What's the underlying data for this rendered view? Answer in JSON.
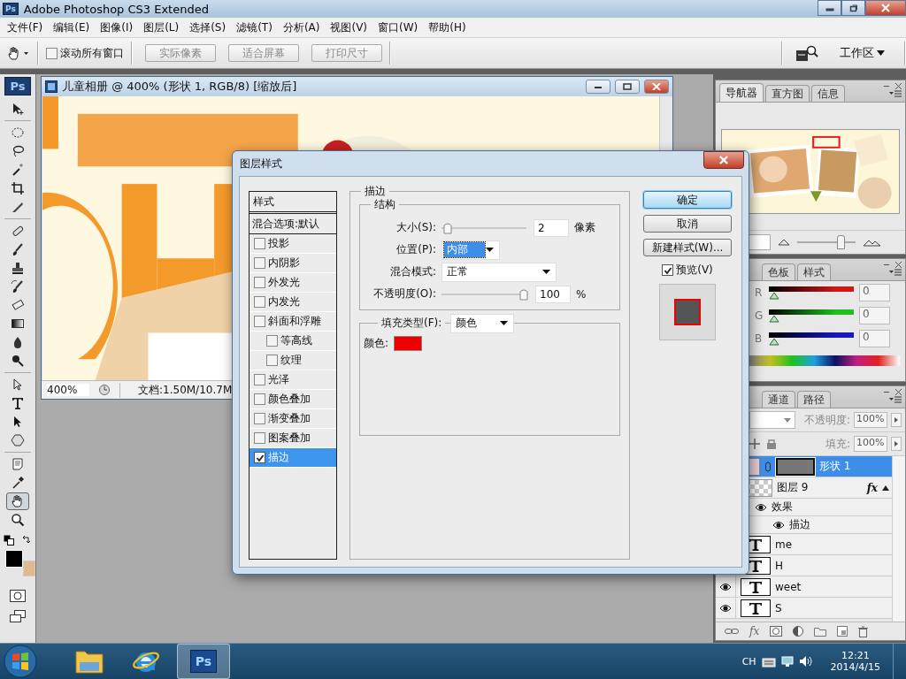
{
  "app": {
    "logo": "Ps",
    "title": "Adobe Photoshop CS3 Extended"
  },
  "menu": [
    "文件(F)",
    "编辑(E)",
    "图像(I)",
    "图层(L)",
    "选择(S)",
    "滤镜(T)",
    "分析(A)",
    "视图(V)",
    "窗口(W)",
    "帮助(H)"
  ],
  "options_bar": {
    "scroll_all": {
      "label": "滚动所有窗口",
      "checked": false
    },
    "buttons": [
      {
        "label": "实际像素",
        "disabled": true
      },
      {
        "label": "适合屏幕",
        "disabled": true
      },
      {
        "label": "打印尺寸",
        "disabled": true
      }
    ],
    "workspace": "工作区"
  },
  "toolbox": {
    "logo": "Ps",
    "tools": [
      {
        "selected": false
      },
      {
        "selected": false
      },
      {
        "selected": false
      },
      {
        "selected": false
      },
      {
        "selected": false
      },
      {
        "selected": false
      },
      {
        "selected": false
      },
      {
        "selected": false
      },
      {
        "selected": false
      },
      {
        "selected": false
      },
      {
        "selected": false
      },
      {
        "selected": false
      },
      {
        "selected": false
      },
      {
        "selected": false
      },
      {
        "selected": false
      },
      {
        "selected": false
      },
      {
        "selected": false
      },
      {
        "selected": false
      },
      {
        "selected": false
      },
      {
        "selected": false
      },
      {
        "selected": true
      },
      {
        "selected": false
      }
    ],
    "swatches": [
      {
        "kind": "foreground",
        "color": "#000000"
      },
      {
        "kind": "background",
        "color": "#e4b88c"
      }
    ]
  },
  "document": {
    "title": "儿童相册 @ 400% (形状 1, RGB/8) [缩放后]",
    "zoom": "400%",
    "doc_info": "文档:1.50M/10.7M"
  },
  "dialog": {
    "title": "图层样式",
    "list_header": "样式",
    "blend_options": "混合选项:默认",
    "effects": [
      {
        "label": "投影",
        "checked": false,
        "selected": false
      },
      {
        "label": "内阴影",
        "checked": false,
        "selected": false
      },
      {
        "label": "外发光",
        "checked": false,
        "selected": false
      },
      {
        "label": "内发光",
        "checked": false,
        "selected": false
      },
      {
        "label": "斜面和浮雕",
        "checked": false,
        "selected": false,
        "children": [
          {
            "label": "等高线",
            "checked": false,
            "selected": false
          },
          {
            "label": "纹理",
            "checked": false,
            "selected": false
          }
        ]
      },
      {
        "label": "光泽",
        "checked": false,
        "selected": false
      },
      {
        "label": "颜色叠加",
        "checked": false,
        "selected": false
      },
      {
        "label": "渐变叠加",
        "checked": false,
        "selected": false
      },
      {
        "label": "图案叠加",
        "checked": false,
        "selected": false
      },
      {
        "label": "描边",
        "checked": true,
        "selected": true
      }
    ],
    "group_title": "描边",
    "structure_title": "结构",
    "size": {
      "label": "大小(S):",
      "level": 0.02,
      "value": "2",
      "unit": "像素"
    },
    "position": {
      "label": "位置(P):",
      "value": "内部"
    },
    "blend_mode": {
      "label": "混合模式:",
      "value": "正常"
    },
    "opacity": {
      "label": "不透明度(O):",
      "level": 1,
      "value": "100",
      "unit": "%"
    },
    "fill_type": {
      "label": "填充类型(F):",
      "value": "颜色"
    },
    "fill_color": {
      "label": "颜色:",
      "color": "#ee0000"
    },
    "buttons": [
      {
        "label": "确定",
        "default": true
      },
      {
        "label": "取消",
        "default": false
      },
      {
        "label": "新建样式(W)...",
        "default": false
      }
    ],
    "preview": {
      "label": "预览(V)",
      "checked": true
    }
  },
  "navigator": {
    "tabs": [
      {
        "label": "导航器",
        "selected": true
      },
      {
        "label": "直方图",
        "selected": false
      },
      {
        "label": "信息",
        "selected": false
      }
    ],
    "zoom": {
      "level": 0.72
    }
  },
  "color_panel": {
    "tabs": [
      {
        "label": "色板",
        "selected": false
      },
      {
        "label": "样式",
        "selected": false
      }
    ],
    "channels": [
      {
        "name": "R",
        "level": 0,
        "value": "0",
        "color": "#d01818"
      },
      {
        "name": "G",
        "level": 0,
        "value": "0",
        "color": "#20c020"
      },
      {
        "name": "B",
        "level": 0,
        "value": "0",
        "color": "#1818c0"
      }
    ]
  },
  "layers_panel": {
    "tabs": [
      {
        "label": "通道",
        "selected": false
      },
      {
        "label": "路径",
        "selected": false
      }
    ],
    "opacity": {
      "label": "不透明度:",
      "value": "100%"
    },
    "fill": {
      "label": "填充:",
      "value": "100%"
    },
    "layers": [
      {
        "kind": "shape",
        "name": "形状 1",
        "selected": true
      },
      {
        "kind": "raster",
        "name": "图层 9",
        "selected": false,
        "fx": "fx",
        "effects": {
          "label": "效果",
          "eye": true,
          "children": [
            {
              "label": "描边",
              "eye": true
            }
          ]
        }
      },
      {
        "kind": "text",
        "name": "me",
        "selected": false
      },
      {
        "kind": "text",
        "name": "H",
        "selected": false
      },
      {
        "kind": "text",
        "name": "weet",
        "selected": false,
        "eye": true
      },
      {
        "kind": "text",
        "name": "S",
        "selected": false,
        "eye": true
      }
    ],
    "footer_fx": "fx"
  },
  "taskbar": {
    "apps": [
      {
        "kind": "explorer",
        "active": false
      },
      {
        "kind": "ie",
        "active": false
      },
      {
        "kind": "photoshop",
        "label": "Ps",
        "active": true
      }
    ],
    "lang": "CH",
    "time": "12:21",
    "date": "2014/4/15"
  }
}
